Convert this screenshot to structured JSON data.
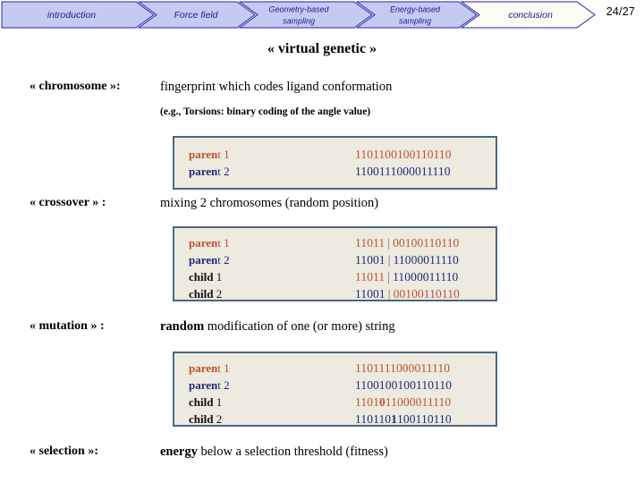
{
  "nav": {
    "items": [
      {
        "label": "introduction",
        "state": "filled",
        "lines": 1
      },
      {
        "label": "Force field",
        "state": "filled",
        "lines": 1
      },
      {
        "label1": "Geometry-based",
        "label2": "sampling",
        "state": "filled",
        "lines": 2
      },
      {
        "label1": "Energy-based",
        "label2": "sampling",
        "state": "filled",
        "lines": 2
      },
      {
        "label": "conclusion",
        "state": "hollow",
        "lines": 1
      }
    ],
    "item0_label": "introduction",
    "item1_label": "Force field",
    "item2_label_line1": "Geometry-based",
    "item2_label_line2": "sampling",
    "item3_label_line1": "Energy-based",
    "item3_label_line2": "sampling",
    "item4_label": "conclusion",
    "page_number": "24/27",
    "fill_color": "#c5caf2",
    "hollow_color": "#fdfcf4",
    "border_color": "#2222aa",
    "text_color": "#1a1a8c"
  },
  "title": "« virtual genetic »",
  "definitions": {
    "chromosome": {
      "term": "« chromosome »:",
      "description": "fingerprint which codes ligand conformation"
    },
    "chromosome_note": "(e.g., Torsions: binary coding of the angle value)",
    "crossover": {
      "term": "« crossover » :",
      "description": "mixing 2 chromosomes (random position)"
    },
    "mutation": {
      "term": "« mutation » :",
      "description_bold": "random",
      "description_rest": " modification of one (or more) string"
    },
    "selection": {
      "term": "« selection »:",
      "description_bold": "energy",
      "description_rest": " below a selection threshold (fitness)"
    }
  },
  "colors": {
    "parent1": "#c1522a",
    "parent2": "#1f2a7a",
    "child_label": "#111111",
    "box_background": "#edeae0",
    "box_border": "#4a6782"
  },
  "boxes": {
    "chromosome": {
      "rows": [
        {
          "label_bold": "paren",
          "label_rest": "t 1",
          "label_color": "parent1",
          "bits": "1101100100110110",
          "bits_color": "parent1"
        },
        {
          "label_bold": "paren",
          "label_rest": "t 2",
          "label_color": "parent2",
          "bits": "1100111000011110",
          "bits_color": "parent2"
        }
      ]
    },
    "crossover": {
      "separator": "|",
      "rows": [
        {
          "label_bold": "paren",
          "label_rest": "t 1",
          "label_color": "parent1",
          "left_bits": "11011",
          "left_color": "parent1",
          "right_bits": "00100110110",
          "right_color": "parent1"
        },
        {
          "label_bold": "paren",
          "label_rest": "t 2",
          "label_color": "parent2",
          "left_bits": "11001",
          "left_color": "parent2",
          "right_bits": "11000011110",
          "right_color": "parent2"
        },
        {
          "label_bold": "child",
          "label_rest": " 1",
          "label_color": "child_label",
          "left_bits": "11011",
          "left_color": "parent1",
          "right_bits": "11000011110",
          "right_color": "parent2"
        },
        {
          "label_bold": "child",
          "label_rest": " 2",
          "label_color": "child_label",
          "left_bits": "11001",
          "left_color": "parent2",
          "right_bits": "00100110110",
          "right_color": "parent1"
        }
      ]
    },
    "mutation": {
      "rows": [
        {
          "label_bold": "paren",
          "label_rest": "t 1",
          "label_color": "parent1",
          "bits": "1101111000011110",
          "bits_color": "parent1",
          "mutated_index": -1
        },
        {
          "label_bold": "paren",
          "label_rest": "t 2",
          "label_color": "parent2",
          "bits": "1100100100110110",
          "bits_color": "parent2",
          "mutated_index": -1
        },
        {
          "label_bold": "child",
          "label_rest": " 1",
          "label_color": "child_label",
          "bits": "1101011000011110",
          "bits_color": "parent1",
          "mutated_index": 4
        },
        {
          "label_bold": "child",
          "label_rest": " 2",
          "label_color": "child_label",
          "bits": "1101101100110110",
          "bits_color": "parent2",
          "mutated_index": 6
        }
      ]
    }
  }
}
